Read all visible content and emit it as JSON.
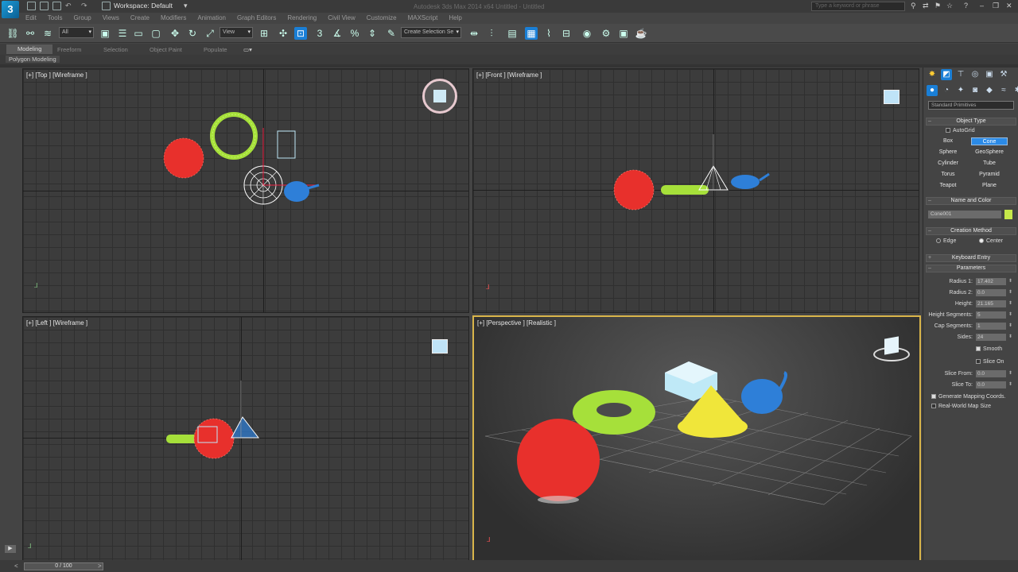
{
  "window": {
    "title": "Autodesk 3ds Max 2014 x64    Untitled - Untitled",
    "workspace": "Workspace: Default",
    "search_placeholder": "Type a keyword or phrase",
    "menu": [
      "Edit",
      "Tools",
      "Group",
      "Views",
      "Create",
      "Modifiers",
      "Animation",
      "Graph Editors",
      "Rendering",
      "Civil View",
      "Customize",
      "MAXScript",
      "Help"
    ]
  },
  "toolbar": {
    "selection_filter": "All",
    "reference_coord": "View",
    "named_selection": "Create Selection Se"
  },
  "ribbon": {
    "tabs": [
      "Modeling",
      "Freeform",
      "Selection",
      "Object Paint",
      "Populate"
    ],
    "active_tab": "Modeling",
    "subtab": "Polygon Modeling"
  },
  "viewports": {
    "top": "[+] [Top ] [Wireframe ]",
    "front": "[+] [Front ] [Wireframe ]",
    "left": "[+] [Left ] [Wireframe ]",
    "perspective": "[+] [Perspective ] [Realistic ]"
  },
  "command_panel": {
    "category_dropdown": "Standard Primitives",
    "object_type": {
      "title": "Object Type",
      "autogrid": "AutoGrid",
      "buttons": [
        "Box",
        "Cone",
        "Sphere",
        "GeoSphere",
        "Cylinder",
        "Tube",
        "Torus",
        "Pyramid",
        "Teapot",
        "Plane"
      ],
      "active": "Cone"
    },
    "name_and_color": {
      "title": "Name and Color",
      "name": "Cone001",
      "color": "#c6e84a"
    },
    "creation_method": {
      "title": "Creation Method",
      "options": [
        "Edge",
        "Center"
      ],
      "selected": "Center"
    },
    "keyboard_entry": "Keyboard Entry",
    "parameters": {
      "title": "Parameters",
      "radius1_label": "Radius 1:",
      "radius1": "17.402",
      "radius2_label": "Radius 2:",
      "radius2": "0.0",
      "height_label": "Height:",
      "height": "21.165",
      "height_segments_label": "Height Segments:",
      "height_segments": "5",
      "cap_segments_label": "Cap Segments:",
      "cap_segments": "1",
      "sides_label": "Sides:",
      "sides": "24",
      "smooth": "Smooth",
      "slice_on": "Slice On",
      "slice_from_label": "Slice From:",
      "slice_from": "0.0",
      "slice_to_label": "Slice To:",
      "slice_to": "0.0",
      "gen_mapping": "Generate Mapping Coords.",
      "real_world": "Real-World Map Size"
    }
  },
  "timeline": {
    "frame": "0 / 100"
  },
  "colors": {
    "accent": "#1a7fd6",
    "sphere": "#e8302c",
    "torus": "#a6e03a",
    "cone": "#f0e63a",
    "teapot": "#2e7fd8",
    "box": "#bfe9f7"
  }
}
